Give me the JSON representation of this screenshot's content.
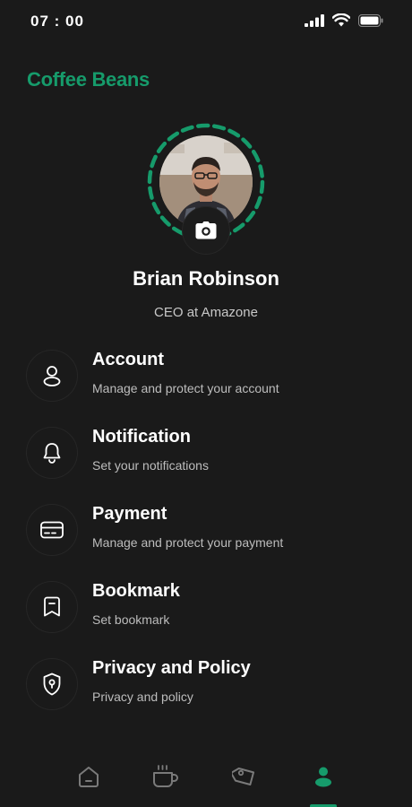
{
  "status_bar": {
    "time": "07 : 00"
  },
  "app": {
    "title": "Coffee Beans",
    "accent_color": "#169b6b"
  },
  "profile": {
    "name": "Brian Robinson",
    "role": "CEO at Amazone",
    "avatar_icon": "user-photo",
    "camera_icon": "camera-icon"
  },
  "menu": {
    "items": [
      {
        "title": "Account",
        "subtitle": "Manage and protect your account",
        "icon": "user-icon"
      },
      {
        "title": "Notification",
        "subtitle": "Set your notifications",
        "icon": "bell-icon"
      },
      {
        "title": "Payment",
        "subtitle": "Manage and protect your payment",
        "icon": "card-icon"
      },
      {
        "title": "Bookmark",
        "subtitle": "Set bookmark",
        "icon": "bookmark-icon"
      },
      {
        "title": "Privacy and Policy",
        "subtitle": "Privacy and policy",
        "icon": "shield-icon"
      }
    ]
  },
  "tab_bar": {
    "tabs": [
      {
        "icon": "home-icon",
        "active": false
      },
      {
        "icon": "coffee-cup-icon",
        "active": false
      },
      {
        "icon": "tag-icon",
        "active": false
      },
      {
        "icon": "profile-icon",
        "active": true
      }
    ],
    "active_color": "#169b6b",
    "inactive_color": "#7a7a7a"
  }
}
